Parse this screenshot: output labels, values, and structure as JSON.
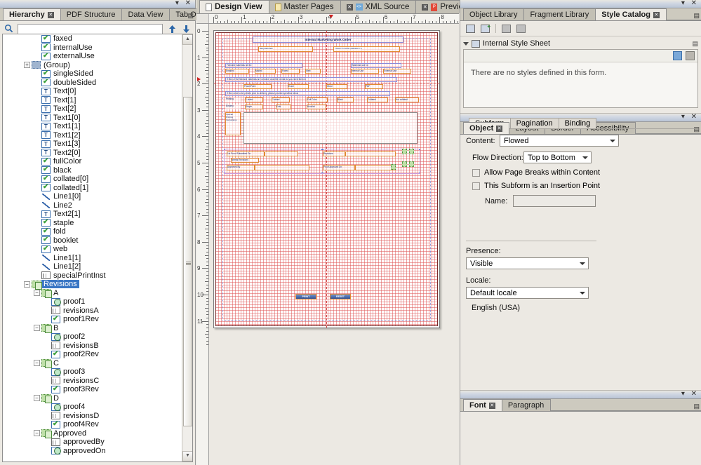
{
  "app": {
    "title": "Adobe LiveCycle Designer"
  },
  "left_panel": {
    "tabs": [
      {
        "label": "Hierarchy",
        "active": true,
        "closable": true
      },
      {
        "label": "PDF Structure",
        "active": false,
        "closable": false
      },
      {
        "label": "Data View",
        "active": false,
        "closable": false
      },
      {
        "label": "Tab Order",
        "active": false,
        "closable": false
      }
    ],
    "search": {
      "value": "",
      "placeholder": ""
    },
    "icons": {
      "search": "search-icon",
      "up": "move-up-icon",
      "down": "move-down-icon"
    },
    "tree": [
      {
        "label": "faxed",
        "depth": 3,
        "icon": "checkbox",
        "expander": "none"
      },
      {
        "label": "internalUse",
        "depth": 3,
        "icon": "checkbox",
        "expander": "none"
      },
      {
        "label": "externalUse",
        "depth": 3,
        "icon": "checkbox",
        "expander": "none"
      },
      {
        "label": "(Group)",
        "depth": 2,
        "icon": "group",
        "expander": "plus"
      },
      {
        "label": "singleSided",
        "depth": 3,
        "icon": "checkbox",
        "expander": "none"
      },
      {
        "label": "doubleSided",
        "depth": 3,
        "icon": "checkbox",
        "expander": "none"
      },
      {
        "label": "Text[0]",
        "depth": 3,
        "icon": "text",
        "expander": "none"
      },
      {
        "label": "Text[1]",
        "depth": 3,
        "icon": "text",
        "expander": "none"
      },
      {
        "label": "Text[2]",
        "depth": 3,
        "icon": "text",
        "expander": "none"
      },
      {
        "label": "Text1[0]",
        "depth": 3,
        "icon": "text",
        "expander": "none"
      },
      {
        "label": "Text1[1]",
        "depth": 3,
        "icon": "text",
        "expander": "none"
      },
      {
        "label": "Text1[2]",
        "depth": 3,
        "icon": "text",
        "expander": "none"
      },
      {
        "label": "Text1[3]",
        "depth": 3,
        "icon": "text",
        "expander": "none"
      },
      {
        "label": "Text2[0]",
        "depth": 3,
        "icon": "text",
        "expander": "none"
      },
      {
        "label": "fullColor",
        "depth": 3,
        "icon": "checkbox",
        "expander": "none"
      },
      {
        "label": "black",
        "depth": 3,
        "icon": "checkbox",
        "expander": "none"
      },
      {
        "label": "collated[0]",
        "depth": 3,
        "icon": "checkbox",
        "expander": "none"
      },
      {
        "label": "collated[1]",
        "depth": 3,
        "icon": "checkbox",
        "expander": "none"
      },
      {
        "label": "Line1[0]",
        "depth": 3,
        "icon": "line",
        "expander": "none"
      },
      {
        "label": "Line2",
        "depth": 3,
        "icon": "line",
        "expander": "none"
      },
      {
        "label": "Text2[1]",
        "depth": 3,
        "icon": "text",
        "expander": "none"
      },
      {
        "label": "staple",
        "depth": 3,
        "icon": "checkbox",
        "expander": "none"
      },
      {
        "label": "fold",
        "depth": 3,
        "icon": "checkbox",
        "expander": "none"
      },
      {
        "label": "booklet",
        "depth": 3,
        "icon": "checkbox",
        "expander": "none"
      },
      {
        "label": "web",
        "depth": 3,
        "icon": "checkbox",
        "expander": "none"
      },
      {
        "label": "Line1[1]",
        "depth": 3,
        "icon": "line",
        "expander": "none"
      },
      {
        "label": "Line1[2]",
        "depth": 3,
        "icon": "line",
        "expander": "none"
      },
      {
        "label": "specialPrintInst",
        "depth": 3,
        "icon": "field",
        "expander": "none"
      },
      {
        "label": "Revisions",
        "depth": 2,
        "icon": "subform",
        "expander": "minus",
        "selected": true
      },
      {
        "label": "A",
        "depth": 3,
        "icon": "subform",
        "expander": "minus"
      },
      {
        "label": "proof1",
        "depth": 4,
        "icon": "date",
        "expander": "none"
      },
      {
        "label": "revisionsA",
        "depth": 4,
        "icon": "field",
        "expander": "none"
      },
      {
        "label": "proof1Rev",
        "depth": 4,
        "icon": "checkbox",
        "expander": "none"
      },
      {
        "label": "B",
        "depth": 3,
        "icon": "subform",
        "expander": "minus"
      },
      {
        "label": "proof2",
        "depth": 4,
        "icon": "date",
        "expander": "none"
      },
      {
        "label": "revisionsB",
        "depth": 4,
        "icon": "field",
        "expander": "none"
      },
      {
        "label": "proof2Rev",
        "depth": 4,
        "icon": "checkbox",
        "expander": "none"
      },
      {
        "label": "C",
        "depth": 3,
        "icon": "subform",
        "expander": "minus"
      },
      {
        "label": "proof3",
        "depth": 4,
        "icon": "date",
        "expander": "none"
      },
      {
        "label": "revisionsC",
        "depth": 4,
        "icon": "field",
        "expander": "none"
      },
      {
        "label": "proof3Rev",
        "depth": 4,
        "icon": "checkbox",
        "expander": "none"
      },
      {
        "label": "D",
        "depth": 3,
        "icon": "subform",
        "expander": "minus"
      },
      {
        "label": "proof4",
        "depth": 4,
        "icon": "date",
        "expander": "none"
      },
      {
        "label": "revisionsD",
        "depth": 4,
        "icon": "field",
        "expander": "none"
      },
      {
        "label": "proof4Rev",
        "depth": 4,
        "icon": "checkbox",
        "expander": "none"
      },
      {
        "label": "Approved",
        "depth": 3,
        "icon": "subform",
        "expander": "minus"
      },
      {
        "label": "approvedBy",
        "depth": 4,
        "icon": "field",
        "expander": "none"
      },
      {
        "label": "approvedOn",
        "depth": 4,
        "icon": "date",
        "expander": "none"
      }
    ]
  },
  "center_panel": {
    "tabs": [
      {
        "label": "Design View",
        "active": true,
        "icon": "page-icon",
        "closable": false
      },
      {
        "label": "Master Pages",
        "active": false,
        "icon": "page-icon",
        "closable": false
      },
      {
        "label": "XML Source",
        "active": false,
        "icon": "xml-icon",
        "closable": true
      },
      {
        "label": "Preview PDF",
        "active": false,
        "icon": "pdf-icon",
        "closable": true
      }
    ],
    "ruler_h": {
      "units": "in",
      "ticks": [
        "0",
        "1",
        "2",
        "3",
        "4",
        "5",
        "6",
        "7",
        "8"
      ],
      "marker_at": 4.1
    },
    "ruler_v": {
      "units": "in",
      "ticks": [
        "0",
        "1",
        "2",
        "3",
        "4",
        "5",
        "6",
        "7",
        "8",
        "9",
        "10",
        "11"
      ],
      "marker_at": 1.75
    },
    "form": {
      "title": "Internal Marketing Work Order",
      "field_labels": [
        "REQUESTER",
        "TODAY'S DATE (MM/DD/YY)"
      ],
      "questions": [
        "Finished materials will be",
        "Materials are for",
        "If files of the finished materials are needed, what file format do you need them in",
        "If files need to be printed prior to delivery, please provide specifics below"
      ],
      "row1_options": [
        "Emailed",
        "Mailed",
        "Faxed",
        "Web",
        "Internal Use",
        "External Use"
      ],
      "row2_options": [
        "PowerPoint",
        "Excel",
        "Word",
        "PDF"
      ],
      "row3_left": "Printing",
      "row3_options": [
        "1-sided",
        "2-sided",
        "Full Color",
        "Black",
        "Collated",
        "Not collated"
      ],
      "row4_left": "Bindery",
      "row4_options": [
        "Staple",
        "Fold",
        "Booklet"
      ],
      "textarea_label": "Special Printing Instructions",
      "proof_labels": [
        "1st Proof Submitted On",
        "Revisions",
        "Needs Revisions",
        "Approved By",
        "Proof Approval On"
      ],
      "buttons": [
        "PRINT",
        "RESET"
      ]
    }
  },
  "right_panel": {
    "library_tabs": [
      {
        "label": "Object Library",
        "active": false,
        "closable": false
      },
      {
        "label": "Fragment Library",
        "active": false,
        "closable": false
      },
      {
        "label": "Style Catalog",
        "active": true,
        "closable": true
      }
    ],
    "style_toolbar_icons": [
      "new-style-icon",
      "add-style-icon",
      "import-style-icon",
      "export-style-icon"
    ],
    "style_sheet": {
      "header": "Internal Style Sheet",
      "header_icon": "style-sheet-icon",
      "empty_message": "There are no styles defined in this form.",
      "mini_icons": [
        "new-style-grid-icon",
        "folder-icon"
      ]
    },
    "object_tabs": [
      {
        "label": "Object",
        "active": true,
        "closable": true
      },
      {
        "label": "Layout",
        "active": false,
        "closable": false
      },
      {
        "label": "Border",
        "active": false,
        "closable": false
      },
      {
        "label": "Accessibility",
        "active": false,
        "closable": false
      }
    ],
    "object_subtabs": [
      {
        "label": "Subform",
        "active": true
      },
      {
        "label": "Pagination",
        "active": false
      },
      {
        "label": "Binding",
        "active": false
      }
    ],
    "object_fields": {
      "content_label": "Content:",
      "content_value": "Flowed",
      "flow_direction_label": "Flow Direction:",
      "flow_direction_value": "Top to Bottom",
      "allow_page_breaks_label": "Allow Page Breaks within Content",
      "allow_page_breaks_checked": false,
      "insertion_point_label": "This Subform is an Insertion Point",
      "insertion_point_checked": false,
      "name_label": "Name:",
      "name_value": "",
      "presence_label": "Presence:",
      "presence_value": "Visible",
      "locale_label": "Locale:",
      "locale_value": "Default locale",
      "locale_note": "English (USA)"
    },
    "font_tabs": [
      {
        "label": "Font",
        "active": true,
        "closable": true
      },
      {
        "label": "Paragraph",
        "active": false,
        "closable": false
      }
    ]
  }
}
